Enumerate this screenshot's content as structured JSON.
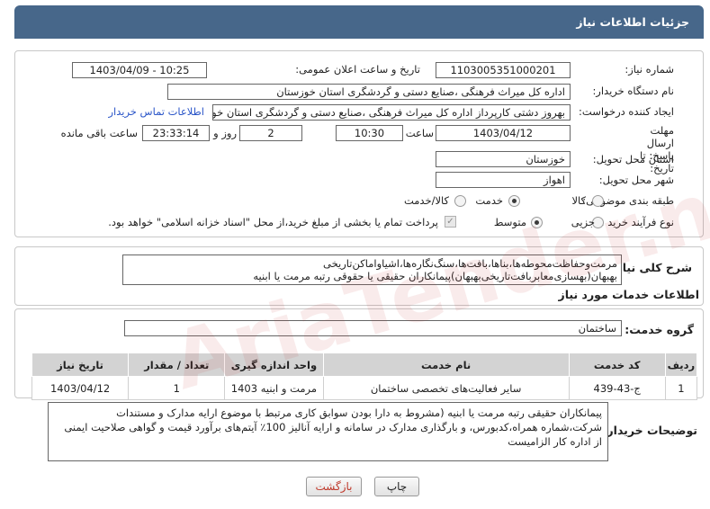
{
  "header": {
    "title": "جزئیات اطلاعات نیاز"
  },
  "fields": {
    "need_number_label": "شماره نیاز:",
    "need_number": "1103005351000201",
    "announce_label": "تاریخ و ساعت اعلان عمومی:",
    "announce_value": "1403/04/09 - 10:25",
    "buyer_org_label": "نام دستگاه خریدار:",
    "buyer_org": "اداره کل میراث فرهنگی ،صنایع دستی و گردشگری استان خوزستان",
    "requester_label": "ایجاد کننده درخواست:",
    "requester": "بهروز دشتی کارپرداز اداره کل میراث فرهنگی ،صنایع دستی و گردشگری استان خوزستان",
    "contact_link": "اطلاعات تماس خریدار",
    "deadline_label": "مهلت ارسال پاسخ: تا تاریخ:",
    "deadline_date": "1403/04/12",
    "time_label": "ساعت",
    "deadline_time": "10:30",
    "days_value": "2",
    "days_label": "روز و",
    "remaining_time": "23:33:14",
    "remaining_label": "ساعت باقی مانده",
    "province_label": "استان محل تحویل:",
    "province": "خوزستان",
    "city_label": "شهر محل تحویل:",
    "city": "اهواز",
    "category_label": "طبقه بندی موضوعی:",
    "category_options": [
      "کالا",
      "خدمت",
      "کالا/خدمت"
    ],
    "process_label": "نوع فرآیند خرید :",
    "process_options": [
      "جزیی",
      "متوسط"
    ],
    "payment_note": "پرداخت تمام یا بخشی از مبلغ خرید،از محل \"اسناد خزانه اسلامی\" خواهد بود."
  },
  "summary": {
    "label": "شرح کلی نیاز:",
    "line1": "مرمت‌وحفاظت‌محوطه‌ها،بناها،بافت‌ها،سنگ‌نگاره‌ها،اشیاواماکن‌تاریخی",
    "line2": "بهبهان(بهسازی‌معابربافت‌تاریخی‌بهبهان)پیمانکاران حقیقی یا حقوقی رتبه مرمت یا ابنیه"
  },
  "services": {
    "section_title": "اطلاعات خدمات مورد نیاز",
    "group_label": "گروه خدمت:",
    "group_value": "ساختمان",
    "columns": [
      "ردیف",
      "کد خدمت",
      "نام خدمت",
      "واحد اندازه گیری",
      "تعداد / مقدار",
      "تاریخ نیاز"
    ],
    "rows": [
      {
        "idx": "1",
        "code": "ج-43-439",
        "name": "سایر فعالیت‌های تخصصی ساختمان",
        "unit": "مرمت و ابنیه 1403",
        "qty": "1",
        "date": "1403/04/12"
      }
    ]
  },
  "notes": {
    "label": "توضیحات خریدار:",
    "line1": "پیمانکاران حقیقی رتبه مرمت یا ابنیه (مشروط به دارا بودن سوابق کاری مرتبط با موضوع ارایه مدارک و مستندات",
    "line2": "شرکت،شماره همراه،کدبورس، و بارگذاری مدارک در سامانه و ارایه آنالیز 100٪ آیتم‌های برآورد قیمت و گواهی صلاحیت ایمنی",
    "line3": "از اداره کار الزامیست"
  },
  "buttons": {
    "print": "چاپ",
    "back": "بازگشت"
  },
  "watermark": "AriaTender.neT",
  "colors": {
    "header": "#47678a",
    "link": "#2a55c8",
    "back_text": "#c0392b"
  }
}
